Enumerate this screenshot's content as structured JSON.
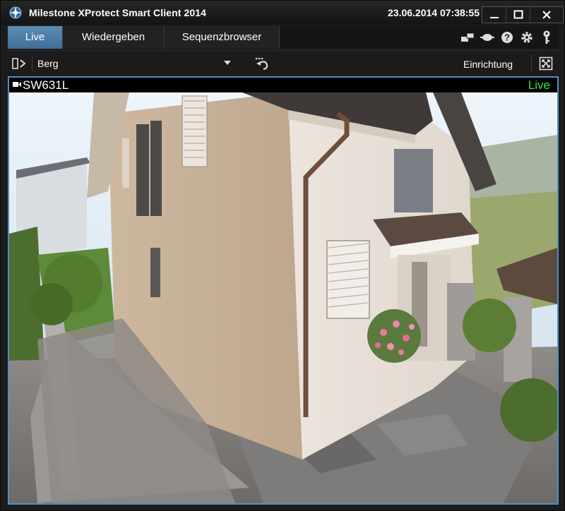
{
  "app": {
    "title": "Milestone XProtect Smart Client 2014",
    "datetime": "23.06.2014 07:38:55"
  },
  "window_controls": [
    "minimize-icon",
    "maximize-icon",
    "close-icon"
  ],
  "tabs": [
    {
      "label": "Live",
      "active": true
    },
    {
      "label": "Wiedergeben",
      "active": false
    },
    {
      "label": "Sequenzbrowser",
      "active": false
    }
  ],
  "tab_bar_icons": [
    "network-icon",
    "camera-status-icon",
    "help-icon",
    "settings-icon",
    "key-icon"
  ],
  "toolbar": {
    "view_name": "Berg",
    "setup_label": "Einrichtung"
  },
  "camera": {
    "name": "SW631L",
    "status": "Live",
    "status_color": "#3ee43e"
  },
  "colors": {
    "accent": "#4f8fc2",
    "active_tab": "#4d7faa"
  }
}
